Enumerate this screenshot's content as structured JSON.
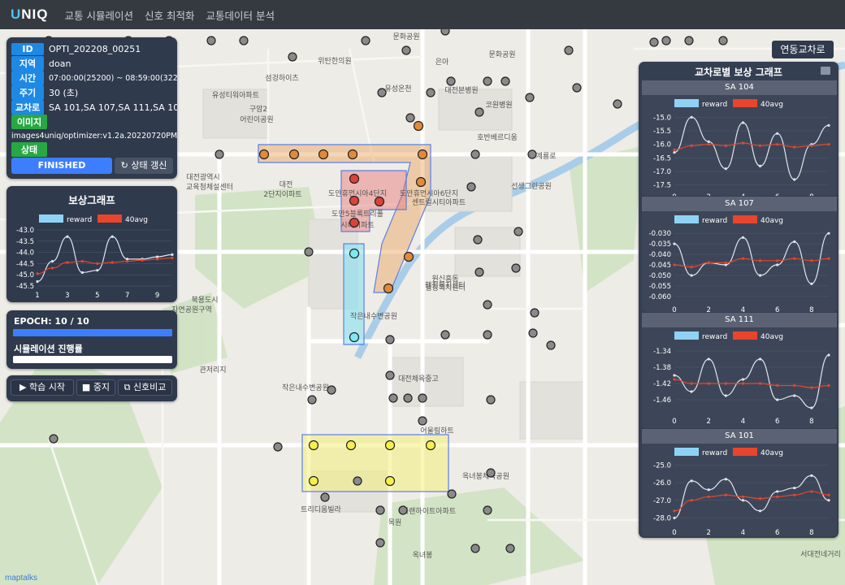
{
  "nav": {
    "brand_a": "U",
    "brand_b": "NIQ",
    "menu": [
      "교통 시뮬레이션",
      "신호 최적화",
      "교통데이터 분석"
    ]
  },
  "info": {
    "id_label": "ID",
    "id": "OPTI_202208_00251",
    "region_label": "지역",
    "region": "doan",
    "time_label": "시간",
    "time": "07:00:00(25200) ~ 08:59:00(32280)",
    "cycle_label": "주기",
    "cycle": "30 (초)",
    "intersection_label": "교차로",
    "intersections": "SA 101,SA 107,SA 111,SA 104",
    "image_label": "이미지",
    "image": "images4uniq/optimizer:v1.2a.20220720PM",
    "status_label": "상태",
    "status": "FINISHED",
    "refresh": "상태 갱신"
  },
  "reward_graph": {
    "title": "보상그래프",
    "legend_reward": "reward",
    "legend_avg": "40avg",
    "yticks": [
      "-43.0",
      "-43.5",
      "-44.0",
      "-44.5",
      "-45.0",
      "-45.5"
    ],
    "xticks": [
      "1",
      "3",
      "5",
      "7",
      "9"
    ]
  },
  "progress": {
    "epoch": "EPOCH: 10 / 10",
    "epoch_value": 1.0,
    "sim_label": "시뮬레이션 진행률",
    "sim_value": 1.0
  },
  "controls": {
    "start": "학습 시작",
    "stop": "중지",
    "compare": "신호비교"
  },
  "right_button": "연동교차로",
  "right_panel": {
    "title": "교차로별 보상 그래프"
  },
  "colors": {
    "reward": "#8fd3f4",
    "avg": "#e8452c",
    "panel": "#2f3a4d"
  },
  "chart_data": [
    {
      "type": "line",
      "title": "보상그래프",
      "x": [
        1,
        2,
        3,
        4,
        5,
        6,
        7,
        8,
        9,
        10
      ],
      "ylim": [
        -45.5,
        -43.0
      ],
      "yticks": [
        "-43.0",
        "-43.5",
        "-44.0",
        "-44.5",
        "-45.0",
        "-45.5"
      ],
      "xticks": [
        "1",
        "3",
        "5",
        "7",
        "9"
      ],
      "series": [
        {
          "name": "reward",
          "values": [
            -45.3,
            -44.4,
            -43.3,
            -44.9,
            -44.8,
            -43.3,
            -44.3,
            -44.3,
            -44.2,
            -44.1
          ]
        },
        {
          "name": "40avg",
          "values": [
            -44.95,
            -44.7,
            -44.45,
            -44.4,
            -44.5,
            -44.45,
            -44.4,
            -44.35,
            -44.3,
            -44.25
          ]
        }
      ]
    },
    {
      "type": "line",
      "title": "SA 104",
      "x": [
        0,
        1,
        2,
        3,
        4,
        5,
        6,
        7,
        8,
        9
      ],
      "ylim": [
        -17.6,
        -14.9
      ],
      "yticks": [
        "-15.0",
        "-15.5",
        "-16.0",
        "-16.5",
        "-17.0",
        "-17.5"
      ],
      "xticks": [
        "0",
        "2",
        "4",
        "6",
        "8"
      ],
      "series": [
        {
          "name": "reward",
          "values": [
            -16.3,
            -15.0,
            -15.9,
            -16.9,
            -15.2,
            -16.8,
            -15.6,
            -17.3,
            -16.0,
            -15.3
          ]
        },
        {
          "name": "40avg",
          "values": [
            -16.2,
            -16.05,
            -16.0,
            -16.05,
            -15.95,
            -16.05,
            -16.0,
            -16.1,
            -16.05,
            -16.0
          ]
        }
      ]
    },
    {
      "type": "line",
      "title": "SA 107",
      "x": [
        0,
        1,
        2,
        3,
        4,
        5,
        6,
        7,
        8,
        9
      ],
      "ylim": [
        -0.062,
        -0.028
      ],
      "yticks": [
        "-0.030",
        "-0.035",
        "-0.040",
        "-0.045",
        "-0.050",
        "-0.055",
        "-0.060"
      ],
      "xticks": [
        "0",
        "2",
        "4",
        "6",
        "8"
      ],
      "series": [
        {
          "name": "reward",
          "values": [
            -0.035,
            -0.05,
            -0.044,
            -0.045,
            -0.032,
            -0.05,
            -0.045,
            -0.034,
            -0.054,
            -0.03
          ]
        },
        {
          "name": "40avg",
          "values": [
            -0.045,
            -0.046,
            -0.044,
            -0.044,
            -0.042,
            -0.043,
            -0.043,
            -0.042,
            -0.043,
            -0.042
          ]
        }
      ]
    },
    {
      "type": "line",
      "title": "SA 111",
      "x": [
        0,
        1,
        2,
        3,
        4,
        5,
        6,
        7,
        8,
        9
      ],
      "ylim": [
        -1.49,
        -1.33
      ],
      "yticks": [
        "-1.34",
        "-1.38",
        "-1.42",
        "-1.46"
      ],
      "xticks": [
        "0",
        "2",
        "4",
        "6",
        "8"
      ],
      "series": [
        {
          "name": "reward",
          "values": [
            -1.4,
            -1.44,
            -1.36,
            -1.45,
            -1.41,
            -1.36,
            -1.46,
            -1.45,
            -1.48,
            -1.35
          ]
        },
        {
          "name": "40avg",
          "values": [
            -1.41,
            -1.42,
            -1.42,
            -1.42,
            -1.42,
            -1.42,
            -1.425,
            -1.425,
            -1.43,
            -1.425
          ]
        }
      ]
    },
    {
      "type": "line",
      "title": "SA 101",
      "x": [
        0,
        1,
        2,
        3,
        4,
        5,
        6,
        7,
        8,
        9
      ],
      "ylim": [
        -28.3,
        -24.8
      ],
      "yticks": [
        "-25.0",
        "-26.0",
        "-27.0",
        "-28.0"
      ],
      "xticks": [
        "0",
        "2",
        "4",
        "6",
        "8"
      ],
      "series": [
        {
          "name": "reward",
          "values": [
            -28.0,
            -25.9,
            -26.4,
            -25.8,
            -27.0,
            -27.6,
            -26.5,
            -26.3,
            -25.6,
            -27.0
          ]
        },
        {
          "name": "40avg",
          "values": [
            -27.6,
            -27.0,
            -26.8,
            -26.7,
            -26.8,
            -26.9,
            -26.8,
            -26.7,
            -26.5,
            -26.7
          ]
        }
      ]
    }
  ],
  "map": {
    "attribution": "maptalks",
    "labels": [
      "문화공원",
      "위탄한의원",
      "섬겅하이츠",
      "유성티워아파트",
      "구암2",
      "어린이공원",
      "대전광역시",
      "교육청체설센터",
      "대전",
      "2단지이파트",
      "도안휴먼시아4단지",
      "도안휴먼시아6단지",
      "센트럴시티아파트",
      "도안5블록트리풀",
      "시티이파트",
      "북용도시",
      "자연공원구역",
      "원신흥동",
      "행정복지센터",
      "작은내수변공원",
      "대전체육중고",
      "관저리지",
      "작은내수변공원",
      "어울림하트",
      "트리디움빌라",
      "파랜하이트아파트",
      "목원",
      "옥녀봉",
      "옥녀봉체육공원",
      "은아",
      "행정복지센터",
      "대전본병원",
      "코원병원",
      "호반베르디움",
      "계룡로",
      "선생그린공원",
      "문화공원",
      "감천로",
      "서대전네거리",
      "유성온천",
      "간선로",
      "리치아파트",
      "리치아파트1"
    ]
  }
}
